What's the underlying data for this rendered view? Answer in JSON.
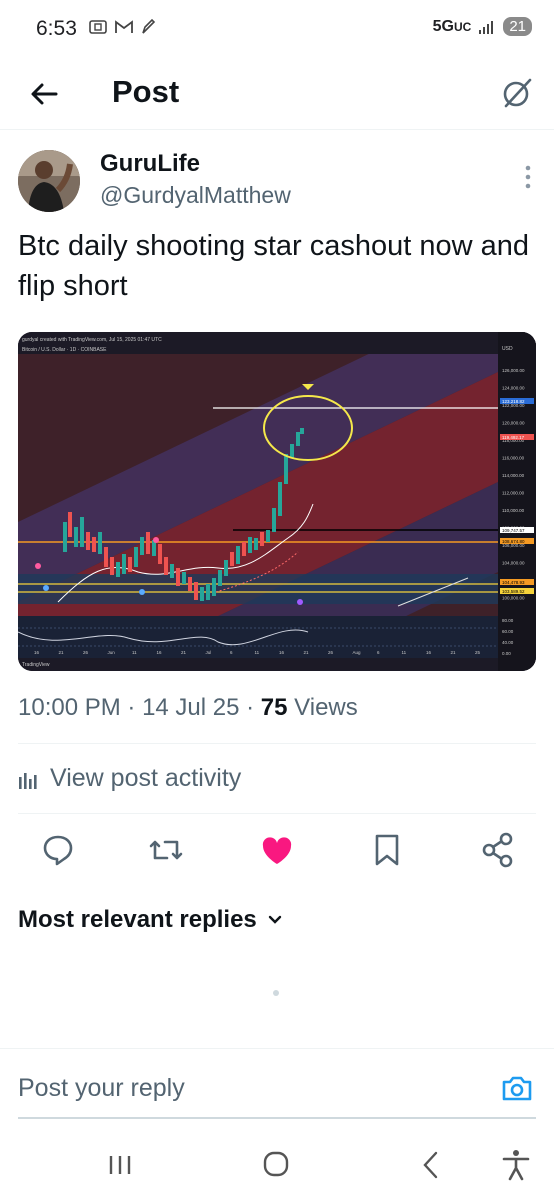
{
  "status_bar": {
    "time": "6:53",
    "network": "5G",
    "network_sub": "UC",
    "battery": "21"
  },
  "header": {
    "title": "Post"
  },
  "author": {
    "name": "GuruLife",
    "handle": "@GurdyalMatthew"
  },
  "post": {
    "text": "Btc daily shooting star cashout now and flip short"
  },
  "meta": {
    "time": "10:00 PM",
    "sep1": " · ",
    "date": "14 Jul 25",
    "sep2": " · ",
    "views_count": "75",
    "views_label": " Views"
  },
  "activity": {
    "label": "View post activity"
  },
  "replies": {
    "heading": "Most relevant replies"
  },
  "reply_input": {
    "placeholder": "Post your reply"
  },
  "chart_image": {
    "header": "gurdyal created with TradingView.com, Jul 15, 2025 01:47 UTC",
    "symbol": "Bitcoin / U.S. Dollar · 1D · COINBASE",
    "currency": "USD",
    "price_ticks": [
      "126,000.00",
      "124,000.00",
      "122,000.00",
      "120,000.00",
      "118,000.00",
      "116,000.00",
      "114,000.00",
      "112,000.00",
      "110,000.00",
      "108,000.00",
      "106,000.00",
      "104,000.00",
      "102,000.00",
      "100,000.00"
    ],
    "osc_ticks": [
      "80.00",
      "60.00",
      "40.00",
      "0.00"
    ],
    "date_ticks": [
      "16",
      "21",
      "26",
      "Jun",
      "11",
      "16",
      "21",
      "Jul",
      "6",
      "11",
      "16",
      "21",
      "26",
      "Aug",
      "6",
      "11",
      "16",
      "21",
      "25"
    ],
    "badges": {
      "high": "123,218.82",
      "close": "119,492.17",
      "level1": "109,747.57",
      "level2": "108,674.80",
      "level3": "104,478.93",
      "level4": "103,589.52"
    },
    "footer": "TradingView",
    "accent_colors": {
      "channel_red": "#7a2430",
      "channel_purple": "#43305e",
      "level_orange": "#f59a23",
      "candle_green": "#26a69a",
      "candle_red": "#ef5350",
      "circle_yellow": "#f5e84a"
    }
  },
  "colors": {
    "like": "#f91880",
    "link_blue": "#1d9bf0",
    "muted": "#536471"
  }
}
